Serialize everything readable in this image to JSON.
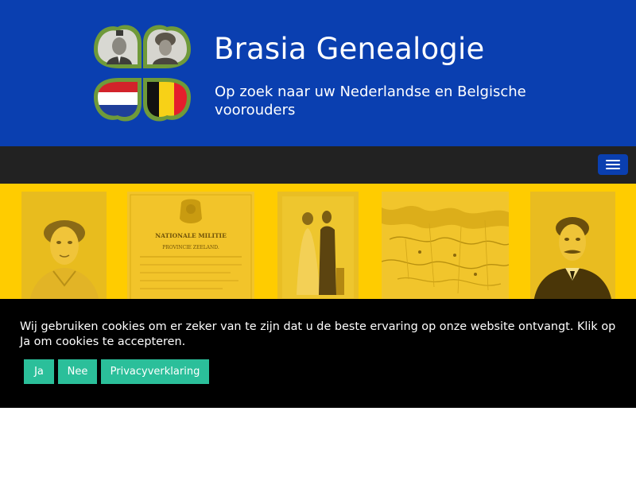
{
  "header": {
    "title": "Brasia Genealogie",
    "tagline": "Op zoek naar uw Nederlandse en Belgische voorouders",
    "background": "#0a3fb0",
    "logo": {
      "icon": "clover-logo-with-portraits-and-flags",
      "flags": [
        "netherlands-flag",
        "belgium-flag"
      ]
    }
  },
  "navbar": {
    "background": "#222222",
    "menu_toggle": {
      "icon": "hamburger-menu-icon",
      "color": "#0a3fb0"
    }
  },
  "banner": {
    "background": "#ffcc00",
    "images": [
      {
        "icon": "woman-portrait-photo"
      },
      {
        "icon": "nationale-militie-document",
        "heading": "NATIONALE MILITIE",
        "subheading": "PROVINCIE ZEELAND."
      },
      {
        "icon": "couple-portrait-photo"
      },
      {
        "icon": "old-map-zeeland"
      },
      {
        "icon": "man-portrait-photo"
      }
    ]
  },
  "cookie_notice": {
    "text": "Wij gebruiken cookies om er zeker van te zijn dat u de beste ervaring op onze website ontvangt. Klik op Ja om cookies te accepteren.",
    "buttons": {
      "accept": "Ja",
      "decline": "Nee",
      "privacy": "Privacyverklaring"
    },
    "button_color": "#2bbf9a",
    "background": "#000000"
  }
}
